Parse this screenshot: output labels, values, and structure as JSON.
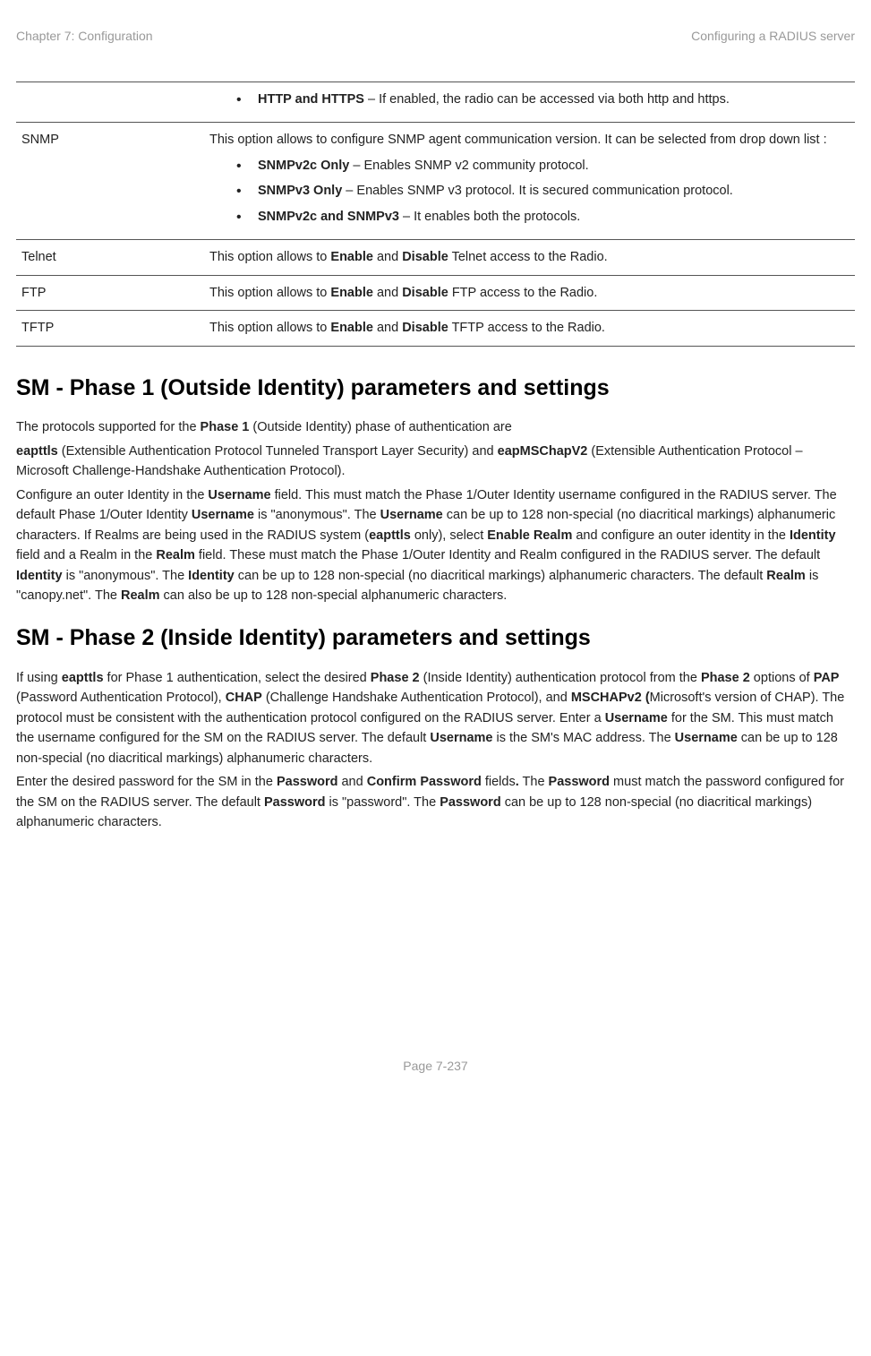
{
  "header": {
    "left": "Chapter 7:  Configuration",
    "right": "Configuring a RADIUS server"
  },
  "table": {
    "row0": {
      "bullet1_bold": "HTTP and HTTPS",
      "bullet1_rest": " – If enabled, the radio can be accessed via both http and https."
    },
    "row1": {
      "label": "SNMP",
      "intro": "This option allows to configure SNMP agent communication version. It can be selected from drop down list :",
      "bullet1_bold": "SNMPv2c Only",
      "bullet1_rest": " – Enables SNMP v2 community protocol.",
      "bullet2_bold": "SNMPv3 Only",
      "bullet2_rest": " – Enables SNMP v3 protocol. It is secured communication protocol.",
      "bullet3_bold": "SNMPv2c and SNMPv3",
      "bullet3_rest": " – It enables both the protocols."
    },
    "row2": {
      "label": "Telnet",
      "text_a": "This option allows to ",
      "text_b": "Enable",
      "text_c": " and ",
      "text_d": "Disable",
      "text_e": " Telnet access to the Radio."
    },
    "row3": {
      "label": "FTP",
      "text_a": "This option allows to ",
      "text_b": "Enable",
      "text_c": " and ",
      "text_d": "Disable",
      "text_e": " FTP access to the Radio."
    },
    "row4": {
      "label": "TFTP",
      "text_a": "This option allows to ",
      "text_b": "Enable",
      "text_c": " and ",
      "text_d": "Disable",
      "text_e": " TFTP access to the Radio."
    }
  },
  "section1": {
    "heading": "SM - Phase 1 (Outside Identity) parameters and settings",
    "p1_a": "The protocols supported for the ",
    "p1_b": "Phase 1",
    "p1_c": " (Outside Identity) phase of authentication are",
    "p2_a": "eapttls",
    "p2_b": " (Extensible Authentication Protocol Tunneled Transport Layer Security) and ",
    "p2_c": "eapMSChapV2",
    "p2_d": " (Extensible Authentication Protocol – Microsoft Challenge-Handshake Authentication Protocol).",
    "p3_a": "Configure an outer Identity in the ",
    "p3_b": "Username",
    "p3_c": " field. This must match the Phase 1/Outer Identity username configured in the RADIUS server. The default Phase 1/Outer Identity ",
    "p3_d": "Username",
    "p3_e": " is \"anonymous\". The ",
    "p3_f": "Username",
    "p3_g": " can be up to 128 non-special (no diacritical markings) alphanumeric characters. If Realms are being used in the RADIUS system (",
    "p3_h": "eapttls",
    "p3_i": " only), select ",
    "p3_j": "Enable Realm",
    "p3_k": " and configure an outer identity in the ",
    "p3_l": "Identity",
    "p3_m": " field and a Realm in the ",
    "p3_n": "Realm",
    "p3_o": " field. These must match the Phase 1/Outer Identity and Realm configured in the RADIUS server. The default ",
    "p3_p": "Identity",
    "p3_q": " is \"anonymous\". The ",
    "p3_r": "Identity",
    "p3_s": " can be up to 128 non-special (no diacritical markings) alphanumeric characters. The default ",
    "p3_t": "Realm",
    "p3_u": " is \"canopy.net\". The ",
    "p3_v": "Realm",
    "p3_w": " can also be up to 128 non-special alphanumeric characters."
  },
  "section2": {
    "heading": "SM - Phase 2 (Inside Identity) parameters and settings",
    "p1_a": "If using ",
    "p1_b": "eapttls",
    "p1_c": " for Phase 1 authentication, select the desired ",
    "p1_d": "Phase 2",
    "p1_e": " (Inside Identity) authentication protocol from the ",
    "p1_f": "Phase 2",
    "p1_g": " options of ",
    "p1_h": "PAP",
    "p1_i": " (Password Authentication Protocol), ",
    "p1_j": "CHAP",
    "p1_k": " (Challenge Handshake Authentication Protocol), and ",
    "p1_l": "MSCHAPv2 (",
    "p1_m": "Microsoft's version of CHAP). The protocol must be consistent with the authentication protocol configured on the RADIUS server. Enter a ",
    "p1_n": "Username",
    "p1_o": " for the SM. This must match the username configured for the SM on the RADIUS server. The default ",
    "p1_p": "Username",
    "p1_q": " is the SM's MAC address. The ",
    "p1_r": "Username",
    "p1_s": " can be up to 128 non-special (no diacritical markings) alphanumeric characters.",
    "p2_a": "Enter the desired password for the SM in the ",
    "p2_b": "Password",
    "p2_c": " and ",
    "p2_d": "Confirm Password",
    "p2_e": " fields",
    "p2_f": ".",
    "p2_g": " The ",
    "p2_h": "Password",
    "p2_i": " must match the password configured for the SM on the RADIUS server. The default ",
    "p2_j": "Password",
    "p2_k": " is \"password\". The ",
    "p2_l": "Password",
    "p2_m": " can be up to 128 non-special (no diacritical markings) alphanumeric characters."
  },
  "footer": "Page 7-237"
}
